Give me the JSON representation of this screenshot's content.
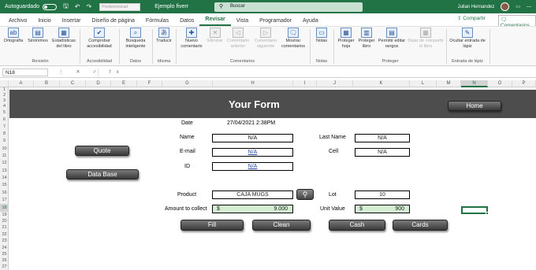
{
  "titlebar": {
    "autosave_label": "Autoguardado",
    "style_placeholder": "Predeterminad",
    "doc_name": "Ejemplo fiverr",
    "search_placeholder": "Buscar",
    "user_name": "Julian Hernandez"
  },
  "menu": {
    "tabs": [
      "Archivo",
      "Inicio",
      "Insertar",
      "Diseño de página",
      "Fórmulas",
      "Datos",
      "Revisar",
      "Vista",
      "Programador",
      "Ayuda"
    ],
    "active": "Revisar",
    "share_label": "Compartir",
    "comments_label": "Comentarios"
  },
  "ribbon": {
    "buttons": {
      "ortografia": "Ortografía",
      "sinonimos": "Sinónimos",
      "estadisticas": "Estadísticas del libro",
      "comprobar": "Comprobar accesibilidad",
      "busqueda": "Búsqueda inteligente",
      "traducir": "Traducir",
      "nuevo_comentario": "Nuevo comentario",
      "eliminar": "Eliminar",
      "comentario_anterior": "Comentario anterior",
      "comentario_siguiente": "Comentario siguiente",
      "mostrar_comentarios": "Mostrar comentarios",
      "notas": "Notas",
      "proteger_hoja": "Proteger hoja",
      "proteger_libro": "Proteger libro",
      "permitir_rangos": "Permitir editar rangos",
      "dejar_compartir": "Dejar de compartir el libro",
      "ocultar_lapiz": "Ocultar entrada de lápiz"
    },
    "groups": {
      "revision": "Revisión",
      "accesibilidad": "Accesibilidad",
      "datos": "Datos",
      "idioma": "Idioma",
      "comentarios": "Comentarios",
      "notas": "Notas",
      "proteger": "Proteger",
      "lapiz": "Entrada de lápiz"
    }
  },
  "formula_bar": {
    "name_box": "N18",
    "icons": "⋮ ✕ ✓ fx",
    "value": ""
  },
  "columns": [
    "A",
    "B",
    "C",
    "D",
    "E",
    "F",
    "G",
    "H",
    "I",
    "J",
    "K",
    "L",
    "M",
    "N",
    "O",
    "P"
  ],
  "selected_column": "N",
  "rows": [
    "1",
    "2",
    "3",
    "4",
    "5",
    "6",
    "7",
    "8",
    "9",
    "10",
    "11",
    "12",
    "13",
    "14",
    "15",
    "16",
    "17",
    "18",
    "19",
    "20",
    "21",
    "22",
    "23",
    "24",
    "25",
    "26",
    "27"
  ],
  "selected_row": "18",
  "form": {
    "title": "Your Form",
    "home_button": "Home",
    "quote_button": "Quote",
    "database_button": "Data Base",
    "date_label": "Date",
    "date_value": "27/04/2021 2:38PM",
    "name_label": "Name",
    "name_value": "N/A",
    "last_name_label": "Last Name",
    "last_name_value": "N/A",
    "email_label": "E-mail",
    "email_value": "N/A",
    "cell_label": "Cell",
    "cell_value": "N/A",
    "id_label": "ID",
    "id_value": "N/A",
    "product_label": "Product",
    "product_value": "CAJA MUGS",
    "lot_label": "Lot",
    "lot_value": "10",
    "amount_label": "Amount to collect",
    "amount_currency": "$",
    "amount_value": "9.000",
    "unit_label": "Unit Value",
    "unit_currency": "$",
    "unit_value": "900",
    "fill_button": "Fill",
    "clean_button": "Clean",
    "cash_button": "Cash",
    "cards_button": "Cards"
  }
}
